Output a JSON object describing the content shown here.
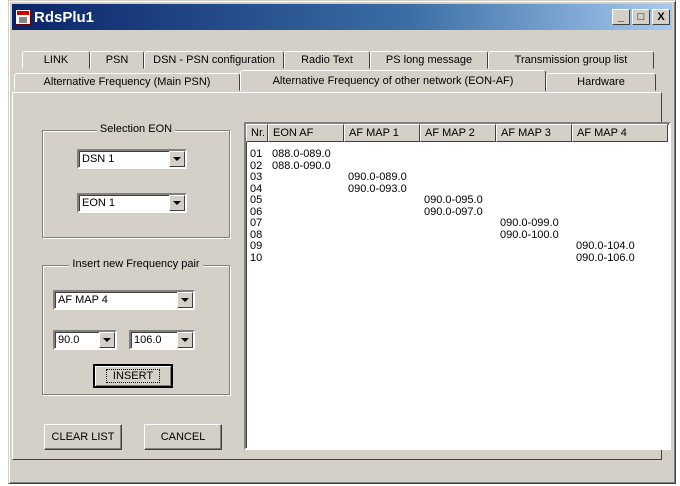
{
  "window": {
    "title": "RdsPlu1"
  },
  "title_buttons": {
    "minimize": "_",
    "restore": "□",
    "close": "X"
  },
  "tabs_row1": [
    "LINK",
    "PSN",
    "DSN - PSN configuration",
    "Radio Text",
    "PS long message",
    "Transmission group list"
  ],
  "tabs_row2": [
    "Alternative Frequency (Main PSN)",
    "Alternative Frequency of other network (EON-AF)",
    "Hardware"
  ],
  "active_tab": "Alternative Frequency of other network (EON-AF)",
  "selection_eon": {
    "legend": "Selection EON",
    "dsn_value": "DSN 1",
    "eon_value": "EON 1"
  },
  "insert_pair": {
    "legend": "Insert new Frequency pair",
    "map_value": "AF MAP 4",
    "freq_from": "90.0",
    "freq_to": "106.0",
    "insert_label": "INSERT"
  },
  "buttons": {
    "clear_list": "CLEAR LIST",
    "cancel": "CANCEL"
  },
  "list": {
    "columns": [
      "Nr.",
      "EON AF",
      "AF MAP 1",
      "AF MAP 2",
      "AF MAP 3",
      "AF MAP 4"
    ],
    "rows": [
      [
        "01",
        "088.0-089.0",
        "",
        "",
        "",
        ""
      ],
      [
        "02",
        "088.0-090.0",
        "",
        "",
        "",
        ""
      ],
      [
        "03",
        "",
        "090.0-089.0",
        "",
        "",
        ""
      ],
      [
        "04",
        "",
        "090.0-093.0",
        "",
        "",
        ""
      ],
      [
        "05",
        "",
        "",
        "090.0-095.0",
        "",
        ""
      ],
      [
        "06",
        "",
        "",
        "090.0-097.0",
        "",
        ""
      ],
      [
        "07",
        "",
        "",
        "",
        "090.0-099.0",
        ""
      ],
      [
        "08",
        "",
        "",
        "",
        "090.0-100.0",
        ""
      ],
      [
        "09",
        "",
        "",
        "",
        "",
        "090.0-104.0"
      ],
      [
        "10",
        "",
        "",
        "",
        "",
        "090.0-106.0"
      ]
    ]
  }
}
